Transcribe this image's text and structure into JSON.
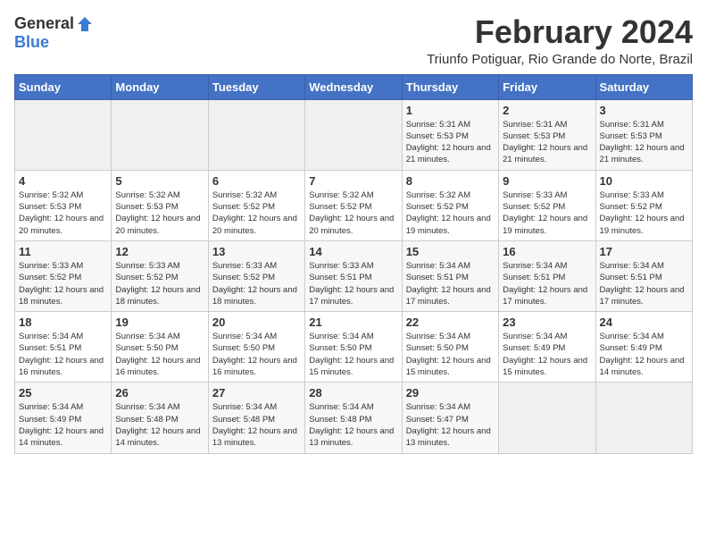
{
  "header": {
    "logo_general": "General",
    "logo_blue": "Blue",
    "month_title": "February 2024",
    "subtitle": "Triunfo Potiguar, Rio Grande do Norte, Brazil"
  },
  "days_of_week": [
    "Sunday",
    "Monday",
    "Tuesday",
    "Wednesday",
    "Thursday",
    "Friday",
    "Saturday"
  ],
  "weeks": [
    [
      {
        "day": "",
        "detail": ""
      },
      {
        "day": "",
        "detail": ""
      },
      {
        "day": "",
        "detail": ""
      },
      {
        "day": "",
        "detail": ""
      },
      {
        "day": "1",
        "detail": "Sunrise: 5:31 AM\nSunset: 5:53 PM\nDaylight: 12 hours and 21 minutes."
      },
      {
        "day": "2",
        "detail": "Sunrise: 5:31 AM\nSunset: 5:53 PM\nDaylight: 12 hours and 21 minutes."
      },
      {
        "day": "3",
        "detail": "Sunrise: 5:31 AM\nSunset: 5:53 PM\nDaylight: 12 hours and 21 minutes."
      }
    ],
    [
      {
        "day": "4",
        "detail": "Sunrise: 5:32 AM\nSunset: 5:53 PM\nDaylight: 12 hours and 20 minutes."
      },
      {
        "day": "5",
        "detail": "Sunrise: 5:32 AM\nSunset: 5:53 PM\nDaylight: 12 hours and 20 minutes."
      },
      {
        "day": "6",
        "detail": "Sunrise: 5:32 AM\nSunset: 5:52 PM\nDaylight: 12 hours and 20 minutes."
      },
      {
        "day": "7",
        "detail": "Sunrise: 5:32 AM\nSunset: 5:52 PM\nDaylight: 12 hours and 20 minutes."
      },
      {
        "day": "8",
        "detail": "Sunrise: 5:32 AM\nSunset: 5:52 PM\nDaylight: 12 hours and 19 minutes."
      },
      {
        "day": "9",
        "detail": "Sunrise: 5:33 AM\nSunset: 5:52 PM\nDaylight: 12 hours and 19 minutes."
      },
      {
        "day": "10",
        "detail": "Sunrise: 5:33 AM\nSunset: 5:52 PM\nDaylight: 12 hours and 19 minutes."
      }
    ],
    [
      {
        "day": "11",
        "detail": "Sunrise: 5:33 AM\nSunset: 5:52 PM\nDaylight: 12 hours and 18 minutes."
      },
      {
        "day": "12",
        "detail": "Sunrise: 5:33 AM\nSunset: 5:52 PM\nDaylight: 12 hours and 18 minutes."
      },
      {
        "day": "13",
        "detail": "Sunrise: 5:33 AM\nSunset: 5:52 PM\nDaylight: 12 hours and 18 minutes."
      },
      {
        "day": "14",
        "detail": "Sunrise: 5:33 AM\nSunset: 5:51 PM\nDaylight: 12 hours and 17 minutes."
      },
      {
        "day": "15",
        "detail": "Sunrise: 5:34 AM\nSunset: 5:51 PM\nDaylight: 12 hours and 17 minutes."
      },
      {
        "day": "16",
        "detail": "Sunrise: 5:34 AM\nSunset: 5:51 PM\nDaylight: 12 hours and 17 minutes."
      },
      {
        "day": "17",
        "detail": "Sunrise: 5:34 AM\nSunset: 5:51 PM\nDaylight: 12 hours and 17 minutes."
      }
    ],
    [
      {
        "day": "18",
        "detail": "Sunrise: 5:34 AM\nSunset: 5:51 PM\nDaylight: 12 hours and 16 minutes."
      },
      {
        "day": "19",
        "detail": "Sunrise: 5:34 AM\nSunset: 5:50 PM\nDaylight: 12 hours and 16 minutes."
      },
      {
        "day": "20",
        "detail": "Sunrise: 5:34 AM\nSunset: 5:50 PM\nDaylight: 12 hours and 16 minutes."
      },
      {
        "day": "21",
        "detail": "Sunrise: 5:34 AM\nSunset: 5:50 PM\nDaylight: 12 hours and 15 minutes."
      },
      {
        "day": "22",
        "detail": "Sunrise: 5:34 AM\nSunset: 5:50 PM\nDaylight: 12 hours and 15 minutes."
      },
      {
        "day": "23",
        "detail": "Sunrise: 5:34 AM\nSunset: 5:49 PM\nDaylight: 12 hours and 15 minutes."
      },
      {
        "day": "24",
        "detail": "Sunrise: 5:34 AM\nSunset: 5:49 PM\nDaylight: 12 hours and 14 minutes."
      }
    ],
    [
      {
        "day": "25",
        "detail": "Sunrise: 5:34 AM\nSunset: 5:49 PM\nDaylight: 12 hours and 14 minutes."
      },
      {
        "day": "26",
        "detail": "Sunrise: 5:34 AM\nSunset: 5:48 PM\nDaylight: 12 hours and 14 minutes."
      },
      {
        "day": "27",
        "detail": "Sunrise: 5:34 AM\nSunset: 5:48 PM\nDaylight: 12 hours and 13 minutes."
      },
      {
        "day": "28",
        "detail": "Sunrise: 5:34 AM\nSunset: 5:48 PM\nDaylight: 12 hours and 13 minutes."
      },
      {
        "day": "29",
        "detail": "Sunrise: 5:34 AM\nSunset: 5:47 PM\nDaylight: 12 hours and 13 minutes."
      },
      {
        "day": "",
        "detail": ""
      },
      {
        "day": "",
        "detail": ""
      }
    ]
  ]
}
